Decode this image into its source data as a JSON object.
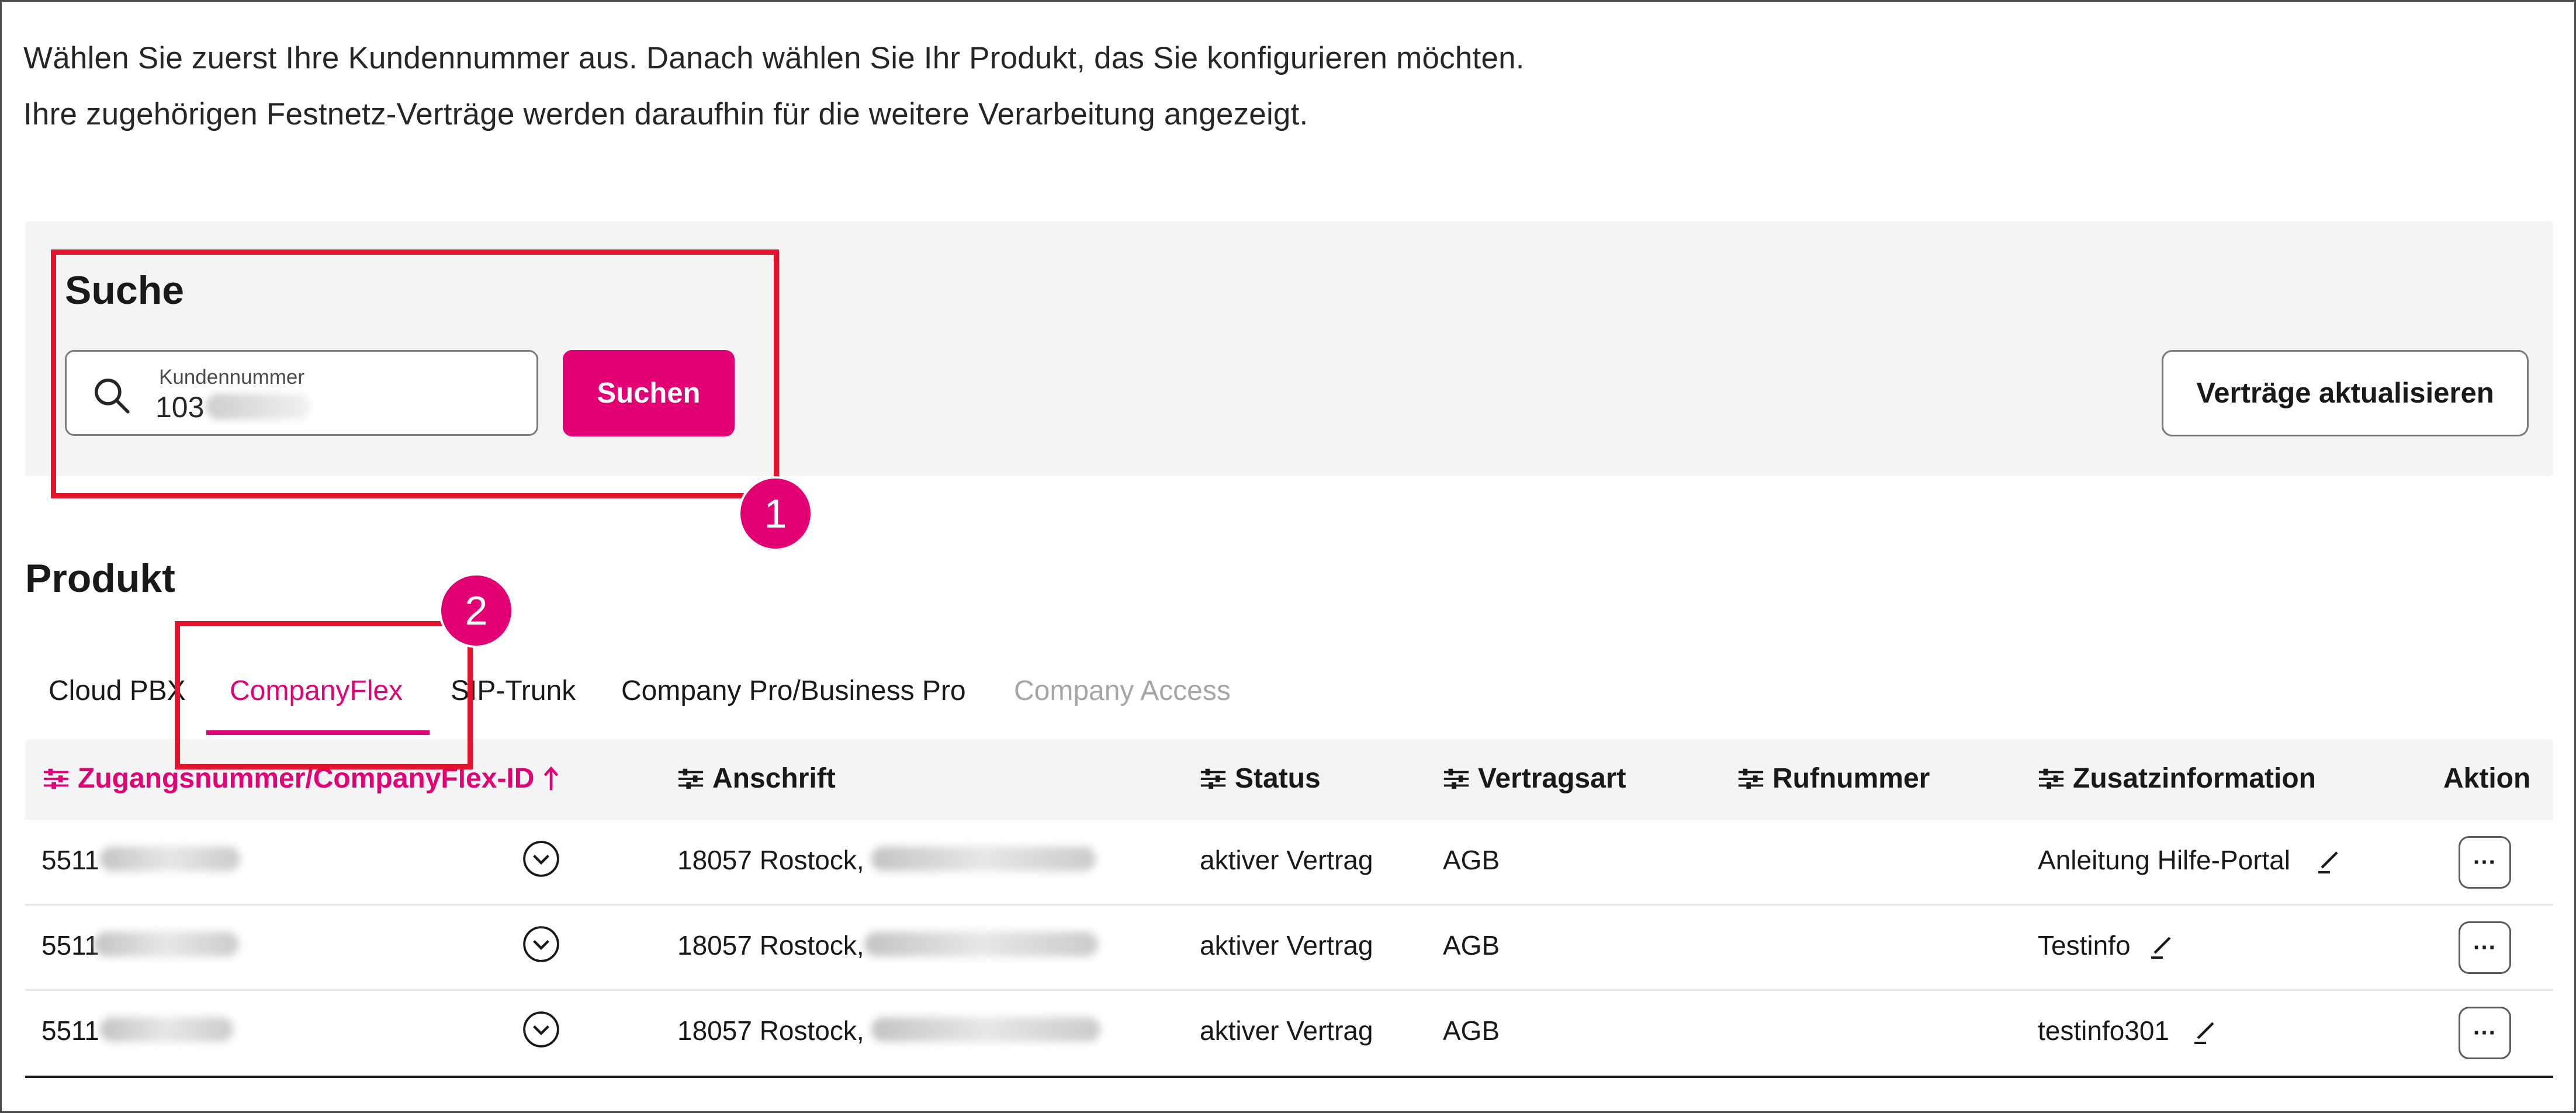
{
  "intro": {
    "line1": "Wählen Sie zuerst Ihre Kundennummer aus. Danach wählen Sie Ihr Produkt, das Sie konfigurieren möchten.",
    "line2": "Ihre zugehörigen Festnetz-Verträge werden daraufhin für die weitere Verarbeitung angezeigt."
  },
  "search": {
    "title": "Suche",
    "field_label": "Kundennummer",
    "field_value": "103",
    "button_label": "Suchen",
    "icon": "search-icon"
  },
  "refresh_button_label": "Verträge aktualisieren",
  "annotations": {
    "badge1": "1",
    "badge2": "2"
  },
  "product": {
    "title": "Produkt",
    "tabs": [
      {
        "label": "Cloud PBX",
        "active": false,
        "disabled": false
      },
      {
        "label": "CompanyFlex",
        "active": true,
        "disabled": false
      },
      {
        "label": "SIP-Trunk",
        "active": false,
        "disabled": false
      },
      {
        "label": "Company Pro/Business Pro",
        "active": false,
        "disabled": false
      },
      {
        "label": "Company Access",
        "active": false,
        "disabled": true
      }
    ]
  },
  "table": {
    "columns": [
      {
        "label": "Zugangsnummer/CompanyFlex-ID",
        "sorted": "ascending",
        "sort_icon": "arrow-up-icon"
      },
      {
        "label": "Anschrift"
      },
      {
        "label": "Status"
      },
      {
        "label": "Vertragsart"
      },
      {
        "label": "Rufnummer"
      },
      {
        "label": "Zusatzinformation"
      },
      {
        "label": "Aktion"
      }
    ],
    "rows": [
      {
        "id": "5511",
        "address": "18057 Rostock,",
        "status": "aktiver Vertrag",
        "contract_type": "AGB",
        "phone": "",
        "info": "Anleitung Hilfe-Portal",
        "action": "···"
      },
      {
        "id": "5511",
        "address": "18057 Rostock,",
        "status": "aktiver Vertrag",
        "contract_type": "AGB",
        "phone": "",
        "info": "Testinfo",
        "action": "···"
      },
      {
        "id": "5511",
        "address": "18057 Rostock,",
        "status": "aktiver Vertrag",
        "contract_type": "AGB",
        "phone": "",
        "info": "testinfo301",
        "action": "···"
      }
    ]
  },
  "colors": {
    "accent": "#e20074",
    "annotation_red": "#e3122d",
    "panel_bg": "#f4f4f4",
    "disabled_text": "#a6a6a6"
  }
}
